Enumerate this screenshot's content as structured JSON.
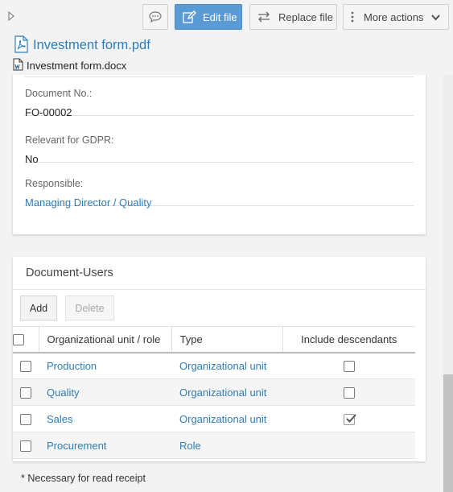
{
  "toolbar": {
    "comment_icon": "comment-icon",
    "edit_label": "Edit file",
    "replace_label": "Replace file",
    "more_label": "More actions",
    "accent": "#5b9bd5"
  },
  "files": {
    "pdf_name": "Investment form.pdf",
    "docx_name": "Investment form.docx"
  },
  "meta": {
    "doc_no_label": "Document No.:",
    "doc_no_value": "FO-00002",
    "gdpr_label": "Relevant for GDPR:",
    "gdpr_value": "No",
    "responsible_label": "Responsible:",
    "responsible_value": "Managing Director / Quality"
  },
  "users": {
    "title": "Document-Users",
    "add_label": "Add",
    "delete_label": "Delete",
    "columns": [
      "Organizational unit / role",
      "Type",
      "Include descendants"
    ],
    "rows": [
      {
        "name": "Production",
        "type": "Organizational unit",
        "include_descendants": false,
        "has_checkbox": true
      },
      {
        "name": "Quality",
        "type": "Organizational unit",
        "include_descendants": false,
        "has_checkbox": true
      },
      {
        "name": "Sales",
        "type": "Organizational unit",
        "include_descendants": true,
        "has_checkbox": true
      },
      {
        "name": "Procurement",
        "type": "Role",
        "include_descendants": false,
        "has_checkbox": false
      }
    ],
    "footnote": "* Necessary for read receipt"
  }
}
